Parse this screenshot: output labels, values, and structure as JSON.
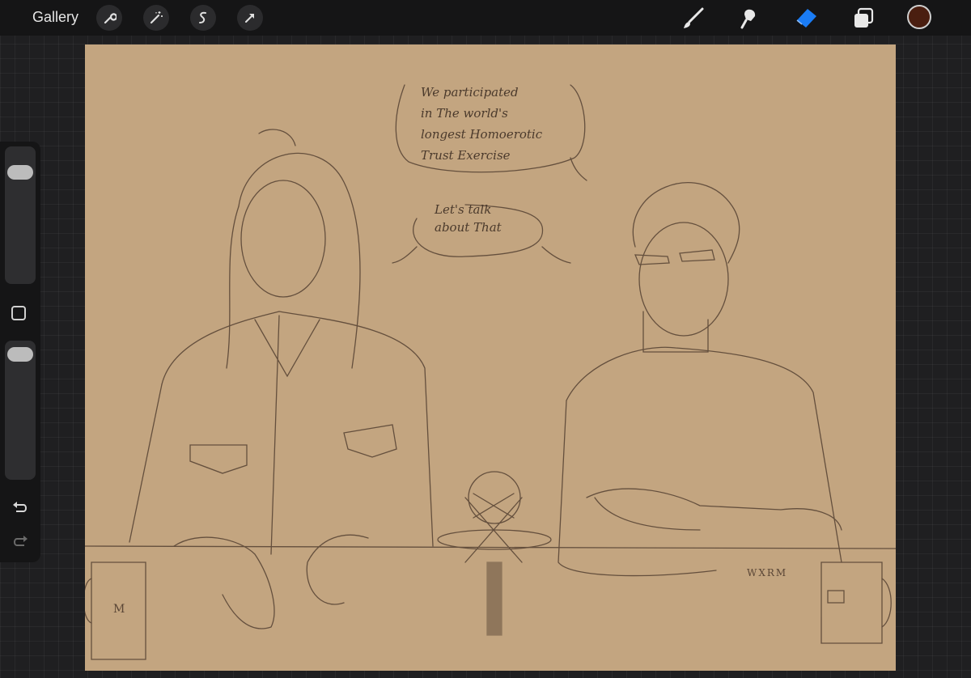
{
  "toolbar": {
    "gallery_label": "Gallery",
    "left_tools": [
      {
        "icon": "wrench-icon",
        "name": "actions"
      },
      {
        "icon": "magic-wand-icon",
        "name": "adjustments"
      },
      {
        "icon": "selection-icon",
        "name": "selection"
      },
      {
        "icon": "arrow-transform-icon",
        "name": "transform"
      }
    ],
    "right_tools": [
      {
        "icon": "brush-icon",
        "name": "brush"
      },
      {
        "icon": "smudge-icon",
        "name": "smudge"
      },
      {
        "icon": "eraser-icon",
        "name": "eraser",
        "active": true
      },
      {
        "icon": "layers-icon",
        "name": "layers"
      }
    ],
    "active_color": "#4a1e10",
    "accent_color": "#1a7cf5"
  },
  "sidebar": {
    "brush_size_level": 0.85,
    "opacity_level": 0.95
  },
  "canvas": {
    "background_color": "#c3a580",
    "speech_bubbles": [
      {
        "text": "We participated\nin The world's\nlongest Homoerotic\nTrust Exercise"
      },
      {
        "text": "Let's talk\nabout That"
      }
    ],
    "signature": "WXRM",
    "mug_label": "M"
  }
}
